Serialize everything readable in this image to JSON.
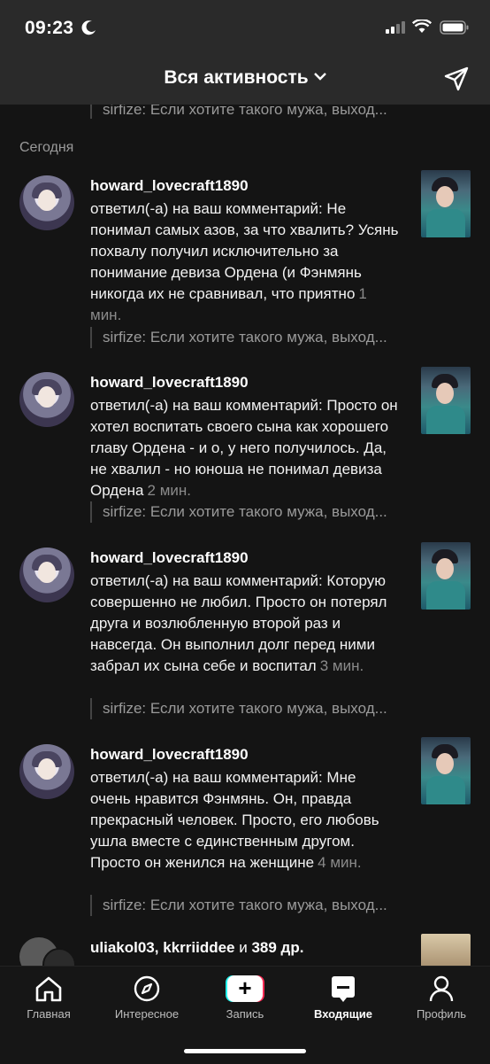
{
  "status": {
    "time": "09:23"
  },
  "header": {
    "title": "Вся активность"
  },
  "previous_quote": "sirfize: Если хотите такого мужа, выход...",
  "section_label": "Сегодня",
  "items": [
    {
      "username": "howard_lovecraft1890",
      "text": "ответил(-а) на ваш комментарий: Не понимал самых азов, за что хвалить? Усянь похвалу получил исключительно за понимание девиза Ордена (и Фэнмянь никогда их не сравнивал, что приятно",
      "time_ago": "1 мин.",
      "quote": "sirfize: Если хотите такого мужа, выход..."
    },
    {
      "username": "howard_lovecraft1890",
      "text": "ответил(-а) на ваш комментарий: Просто он хотел воспитать своего сына как хорошего главу Ордена - и о, у него получилось. Да, не хвалил - но юноша не понимал девиза Ордена",
      "time_ago": "2 мин.",
      "quote": "sirfize: Если хотите такого мужа, выход..."
    },
    {
      "username": "howard_lovecraft1890",
      "text": "ответил(-а) на ваш комментарий: Которую совершенно не любил. Просто он потерял друга и возлюбленную второй раз и навсегда. Он выполнил долг перед ними забрал их сына себе и воспитал",
      "time_ago": "3 мин.",
      "quote": "sirfize: Если хотите такого мужа, выход..."
    },
    {
      "username": "howard_lovecraft1890",
      "text": "ответил(-а) на ваш комментарий: Мне очень нравится Фэнмянь. Он, правда прекрасный человек. Просто, его любовь ушла вместе с единственным другом. Просто он женился на женщине",
      "time_ago": "4 мин.",
      "quote": "sirfize: Если хотите такого мужа, выход..."
    }
  ],
  "last_item": {
    "user1": "uliakol03",
    "sep": ",",
    "user2": "kkrriiddee",
    "and": "и",
    "others": "389 др."
  },
  "tabs": [
    {
      "label": "Главная",
      "icon": "home-icon"
    },
    {
      "label": "Интересное",
      "icon": "compass-icon"
    },
    {
      "label": "Запись",
      "icon": "plus-icon"
    },
    {
      "label": "Входящие",
      "icon": "inbox-icon"
    },
    {
      "label": "Профиль",
      "icon": "profile-icon"
    }
  ],
  "colors": {
    "background": "#141414",
    "header": "#2a2a2a",
    "muted": "#9a9a9a",
    "accent_cyan": "#25f4ee",
    "accent_red": "#fe2c55"
  }
}
